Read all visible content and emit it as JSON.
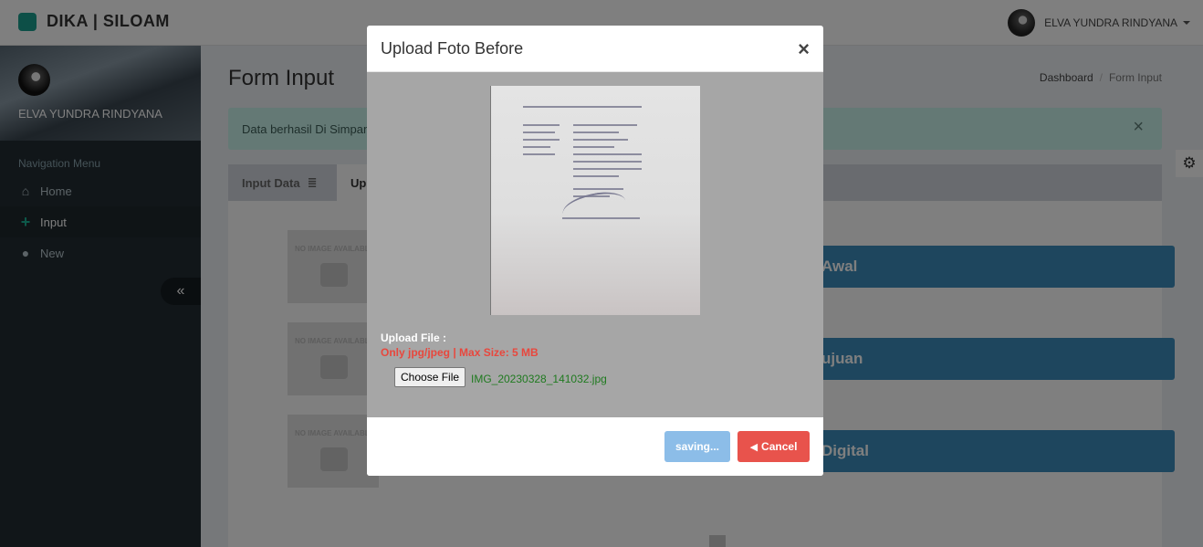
{
  "app": {
    "brand": "DIKA | SILOAM"
  },
  "header": {
    "user_name": "ELVA YUNDRA RINDYANA"
  },
  "sidebar": {
    "user_name": "ELVA YUNDRA RINDYANA",
    "nav_header": "Navigation Menu",
    "items": [
      {
        "label": "Home",
        "icon": "home-icon"
      },
      {
        "label": "Input",
        "icon": "plus-icon"
      },
      {
        "label": "New",
        "icon": "user-icon"
      }
    ]
  },
  "page": {
    "title": "Form Input",
    "breadcrumb": [
      "Dashboard",
      "Form Input"
    ],
    "alert": "Data berhasil Di Simpan",
    "tabs": [
      "Input Data",
      "Up"
    ],
    "no_image_text": "NO IMAGE AVAILABLE",
    "big_buttons": [
      "Awal",
      "ujuan",
      "Digital"
    ]
  },
  "modal": {
    "title": "Upload Foto Before",
    "close": "×",
    "upload_label": "Upload File :",
    "upload_hint": "Only jpg/jpeg | Max Size: 5 MB",
    "choose_file": "Choose File",
    "file_name": "IMG_20230328_141032.jpg",
    "saving_label": "saving...",
    "cancel_label": "Cancel"
  }
}
